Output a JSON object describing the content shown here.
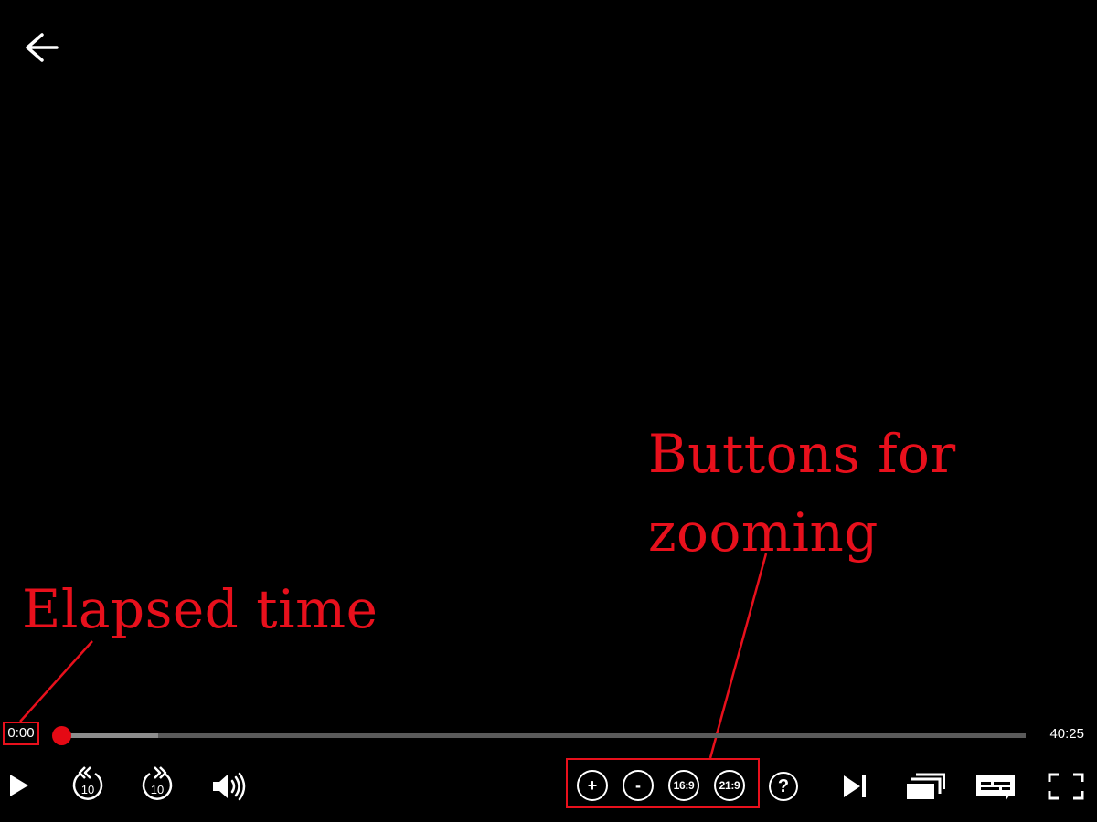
{
  "player": {
    "elapsed_time": "0:00",
    "total_time": "40:25",
    "progress": 0.0,
    "buffered": 0.1
  },
  "controls": {
    "back_icon": "arrow-left-icon",
    "play_icon": "play-icon",
    "rewind_label": "10",
    "forward_label": "10",
    "volume_icon": "volume-icon",
    "help_label": "?",
    "next_episode_icon": "skip-next-icon",
    "episodes_icon": "episodes-icon",
    "subtitles_icon": "subtitles-icon",
    "fullscreen_icon": "fullscreen-icon"
  },
  "zoom_buttons": {
    "zoom_in": "+",
    "zoom_out": "-",
    "ratio_16_9": "16:9",
    "ratio_21_9": "21:9"
  },
  "annotations": {
    "zoom_line1": "Buttons for",
    "zoom_line2": "zooming",
    "elapsed": "Elapsed time"
  },
  "colors": {
    "background": "#000000",
    "accent_red": "#e50914",
    "annotation_red": "#e8101c",
    "track": "#5a5a5a",
    "buffer": "#8c8c8c"
  }
}
